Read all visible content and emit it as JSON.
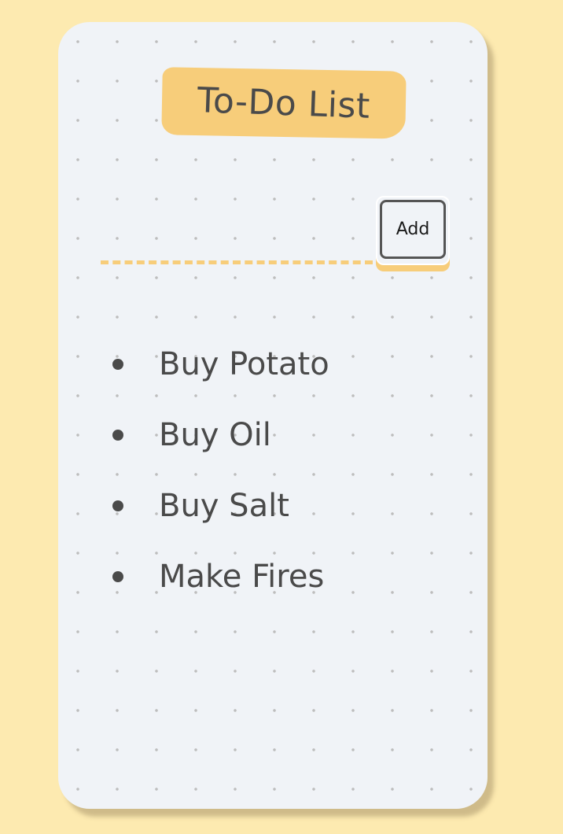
{
  "app": {
    "title": "To-Do List"
  },
  "input": {
    "value": "",
    "placeholder": ""
  },
  "add_button": {
    "label": "Add"
  },
  "tasks": [
    {
      "label": "Buy Potato"
    },
    {
      "label": "Buy Oil"
    },
    {
      "label": "Buy Salt"
    },
    {
      "label": "Make Fires"
    }
  ],
  "colors": {
    "page_background": "#FDEAB0",
    "card_background": "#F0F3F7",
    "accent": "#F7CD7A",
    "text": "#4A4A4A"
  }
}
